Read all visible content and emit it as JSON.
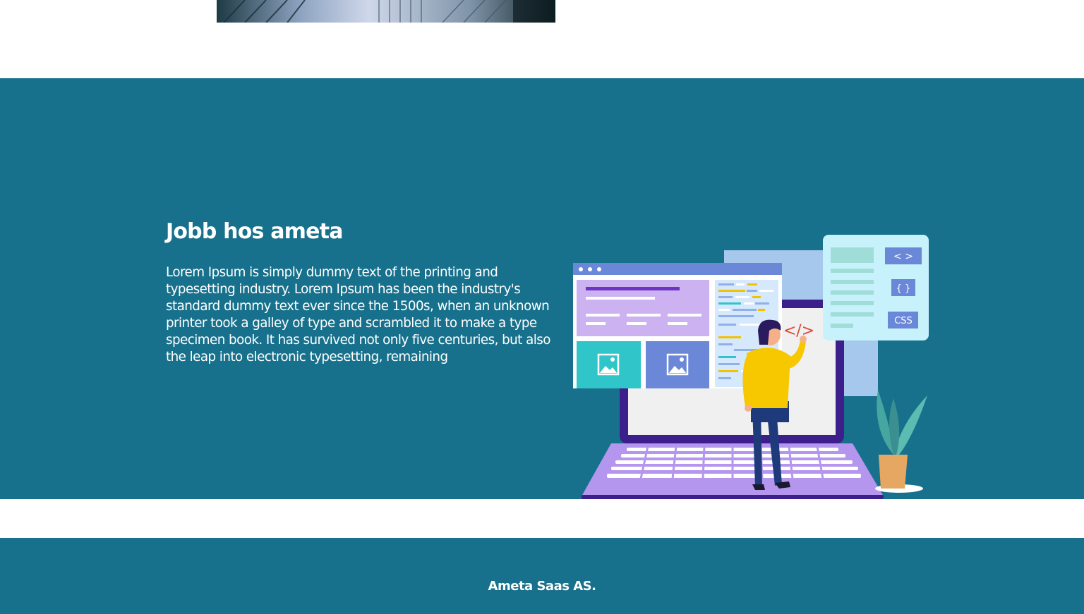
{
  "jobs": {
    "heading": "Jobb hos ameta",
    "body": "Lorem Ipsum is simply dummy text of the printing and typesetting industry. Lorem Ipsum has been the industry's standard dummy text ever since the 1500s, when an unknown printer took a galley of type and scrambled it to make a type specimen book. It has survived not only five centuries, but also the leap into electronic typesetting, remaining"
  },
  "illustration": {
    "code_tag": "</>",
    "panel_labels": [
      "< >",
      "{ }",
      "CSS"
    ]
  },
  "footer": {
    "company": "Ameta Saas AS."
  },
  "colors": {
    "section_bg": "#18718c",
    "page_bg": "#ffffff",
    "text": "#ffffff"
  }
}
